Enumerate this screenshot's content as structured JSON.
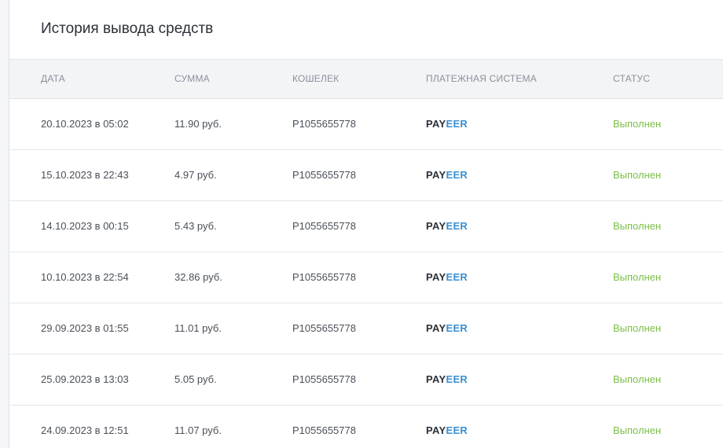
{
  "page": {
    "title": "История вывода средств"
  },
  "table": {
    "headers": {
      "date": "ДАТА",
      "sum": "СУММА",
      "wallet": "КОШЕЛЕК",
      "system": "ПЛАТЕЖНАЯ СИСТЕМА",
      "status": "СТАТУС"
    },
    "rows": [
      {
        "date": "20.10.2023 в 05:02",
        "sum": "11.90 руб.",
        "wallet": "P1055655778",
        "system_a": "PAY",
        "system_b": "EER",
        "status": "Выполнен"
      },
      {
        "date": "15.10.2023 в 22:43",
        "sum": "4.97 руб.",
        "wallet": "P1055655778",
        "system_a": "PAY",
        "system_b": "EER",
        "status": "Выполнен"
      },
      {
        "date": "14.10.2023 в 00:15",
        "sum": "5.43 руб.",
        "wallet": "P1055655778",
        "system_a": "PAY",
        "system_b": "EER",
        "status": "Выполнен"
      },
      {
        "date": "10.10.2023 в 22:54",
        "sum": "32.86 руб.",
        "wallet": "P1055655778",
        "system_a": "PAY",
        "system_b": "EER",
        "status": "Выполнен"
      },
      {
        "date": "29.09.2023 в 01:55",
        "sum": "11.01 руб.",
        "wallet": "P1055655778",
        "system_a": "PAY",
        "system_b": "EER",
        "status": "Выполнен"
      },
      {
        "date": "25.09.2023 в 13:03",
        "sum": "5.05 руб.",
        "wallet": "P1055655778",
        "system_a": "PAY",
        "system_b": "EER",
        "status": "Выполнен"
      },
      {
        "date": "24.09.2023 в 12:51",
        "sum": "11.07 руб.",
        "wallet": "P1055655778",
        "system_a": "PAY",
        "system_b": "EER",
        "status": "Выполнен"
      }
    ]
  },
  "colors": {
    "status_success": "#7cbf49",
    "payeer_dark": "#2b3038",
    "payeer_blue": "#3a8fd0"
  }
}
